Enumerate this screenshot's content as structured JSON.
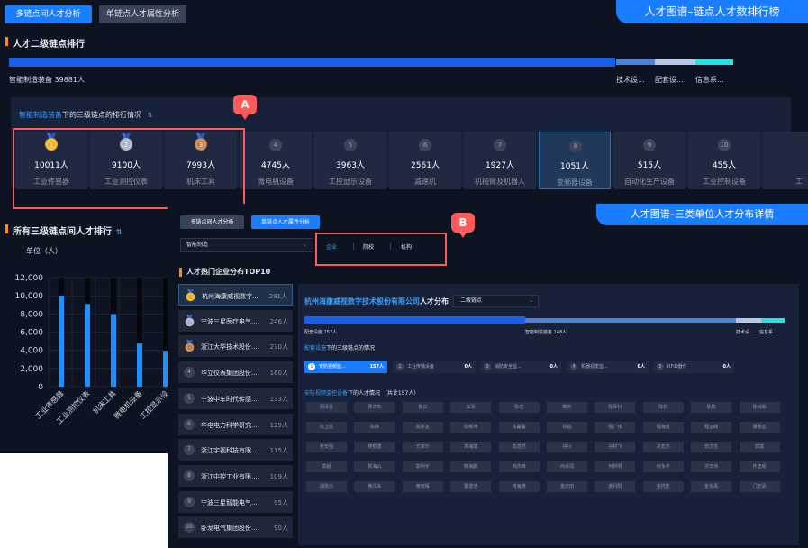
{
  "top": {
    "tabs": [
      {
        "label": "多链点间人才分析",
        "active": true
      },
      {
        "label": "单链点人才属性分析",
        "active": false
      }
    ],
    "banner": "人才图谱–链点人才数排行榜",
    "section1_title": "人才二级链点排行",
    "bar_primary": "智能制造装备 39881人",
    "bar_others": [
      "技术设...",
      "配套设...",
      "信息系..."
    ],
    "ranking_header_highlight": "智能制造装备",
    "ranking_header_rest": "下的三级链点的排行情况",
    "cards": [
      {
        "rank": "1",
        "count": "10011人",
        "label": "工业传感器"
      },
      {
        "rank": "2",
        "count": "9100人",
        "label": "工业测控仪表"
      },
      {
        "rank": "3",
        "count": "7993人",
        "label": "机床工具"
      },
      {
        "rank": "4",
        "count": "4745人",
        "label": "微电机设备"
      },
      {
        "rank": "5",
        "count": "3963人",
        "label": "工控显示设备"
      },
      {
        "rank": "6",
        "count": "2561人",
        "label": "减速机"
      },
      {
        "rank": "7",
        "count": "1927人",
        "label": "机械臂及机器人"
      },
      {
        "rank": "8",
        "count": "1051人",
        "label": "变频器设备"
      },
      {
        "rank": "9",
        "count": "515人",
        "label": "自动化生产设备"
      },
      {
        "rank": "10",
        "count": "455人",
        "label": "工业控制设备"
      },
      {
        "rank": "",
        "count": "",
        "label": "工"
      }
    ],
    "callout_a": "A",
    "section2_title": "所有三级链点间人才排行",
    "unit_label": "单位（人）"
  },
  "chart_data": {
    "type": "bar",
    "categories": [
      "工业传感器",
      "工业测控仪表",
      "机床工具",
      "微电机设备",
      "工控显示设"
    ],
    "values": [
      10011,
      9100,
      7993,
      4745,
      3963
    ],
    "ylim": [
      0,
      12000
    ],
    "yticks": [
      "12,000",
      "10,000",
      "8,000",
      "6,000",
      "4,000",
      "2,000",
      "0"
    ],
    "bar_color": "#1e90ff",
    "grid": true
  },
  "overlay": {
    "tabs": [
      {
        "label": "多链点间人才分析",
        "active": false
      },
      {
        "label": "单链点人才属性分析",
        "active": true
      }
    ],
    "banner": "人才图谱–三类单位人才分布详情",
    "dropdown": "智能制造",
    "unit_tabs": [
      "企业",
      "院校",
      "机构"
    ],
    "callout_b": "B",
    "list_title": "人才热门企业分布TOP10",
    "companies": [
      {
        "rank": "1",
        "name": "杭州海康威视数字...",
        "value": "291人"
      },
      {
        "rank": "2",
        "name": "宁波三星医疗电气...",
        "value": "246人"
      },
      {
        "rank": "3",
        "name": "浙江大华技术股份...",
        "value": "230人"
      },
      {
        "rank": "4",
        "name": "华立仪表集团股份...",
        "value": "160人"
      },
      {
        "rank": "5",
        "name": "宁波中车时代传感...",
        "value": "133人"
      },
      {
        "rank": "6",
        "name": "华电电力科学研究...",
        "value": "129人"
      },
      {
        "rank": "7",
        "name": "浙江宇视科技有限...",
        "value": "115人"
      },
      {
        "rank": "8",
        "name": "浙江中控工业有限...",
        "value": "109人"
      },
      {
        "rank": "9",
        "name": "宁波三星智能电气...",
        "value": "95人"
      },
      {
        "rank": "10",
        "name": "卧龙电气集团股份...",
        "value": "90人"
      }
    ],
    "detail_title_highlight": "杭州海康威视数字技术股份有限公司",
    "detail_title_rest": "人才分布",
    "detail_dropdown": "二级链点",
    "bar_left_label": "配套设施 157人",
    "bar_mid_label": "智能制造装备 148人",
    "bar_right_labels": [
      "技术设...",
      "信息系..."
    ],
    "sub_header_highlight": "配套设施",
    "sub_header_rest": "下的三级链点的情况",
    "pills": [
      {
        "n": "1",
        "label": "安防视频监...",
        "value": "157人",
        "active": true
      },
      {
        "n": "2",
        "label": "工业传输设备",
        "value": "0人",
        "active": false
      },
      {
        "n": "3",
        "label": "消防安全监...",
        "value": "0人",
        "active": false
      },
      {
        "n": "4",
        "label": "机器视觉监...",
        "value": "0人",
        "active": false
      },
      {
        "n": "5",
        "label": "RFID器件",
        "value": "0人",
        "active": false
      }
    ],
    "grid_header_highlight": "安防视频监控设备",
    "grid_header_rest": "下的人才情况 （共计157人）",
    "people": [
      "顾清青",
      "曹华东",
      "鲁云",
      "车军",
      "陈浩",
      "陈杰",
      "陈军科",
      "陈权",
      "陈鹏",
      "陈树毅",
      "陈卫勇",
      "陈锋",
      "陈新友",
      "陈维坤",
      "陈馨馨",
      "陈喆",
      "程广伟",
      "程海波",
      "程运峰",
      "董惠芸",
      "杜安强",
      "樊根德",
      "方家乐",
      "高海斌",
      "高浩然",
      "谷川",
      "谷利飞",
      "关宏杰",
      "管文吉",
      "郭斌",
      "郭超",
      "郭海山",
      "郭明宇",
      "韩海鹏",
      "韩杰西",
      "何承润",
      "何林明",
      "何永丰",
      "洪华伟",
      "怀忠昭",
      "胡扬杰",
      "黄凡夫",
      "黄晓辉",
      "霍诺浩",
      "蒋海涛",
      "金庆田",
      "金丹阳",
      "金祥庆",
      "金永禹",
      "门宏武"
    ]
  }
}
